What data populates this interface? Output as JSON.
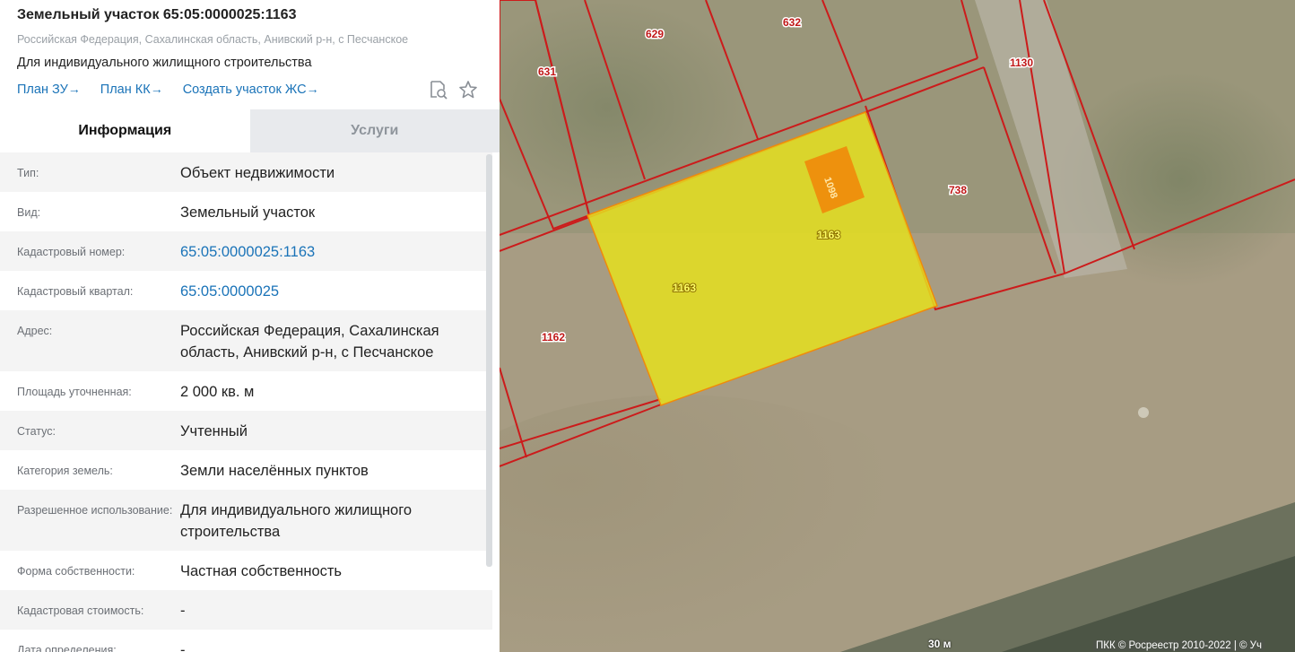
{
  "header": {
    "title": "Земельный участок 65:05:0000025:1163",
    "address": "Российская Федерация, Сахалинская область, Анивский р-н, с Песчанское",
    "purpose": "Для индивидуального жилищного строительства",
    "links": [
      {
        "label": "План ЗУ",
        "arrow": "→"
      },
      {
        "label": "План КК",
        "arrow": "→"
      },
      {
        "label": "Создать участок ЖС",
        "arrow": "→"
      }
    ],
    "icons": [
      "search-document-icon",
      "star-icon"
    ]
  },
  "tabs": [
    {
      "label": "Информация",
      "active": true
    },
    {
      "label": "Услуги",
      "active": false
    }
  ],
  "info_rows": [
    {
      "label": "Тип:",
      "value": "Объект недвижимости",
      "link": false
    },
    {
      "label": "Вид:",
      "value": "Земельный участок",
      "link": false
    },
    {
      "label": "Кадастровый номер:",
      "value": "65:05:0000025:1163",
      "link": true
    },
    {
      "label": "Кадастровый квартал:",
      "value": "65:05:0000025",
      "link": true
    },
    {
      "label": "Адрес:",
      "value": "Российская Федерация, Сахалинская область, Анивский р-н, с Песчанское",
      "link": false
    },
    {
      "label": "Площадь уточненная:",
      "value": "2 000 кв. м",
      "link": false
    },
    {
      "label": "Статус:",
      "value": "Учтенный",
      "link": false
    },
    {
      "label": "Категория земель:",
      "value": "Земли населённых пунктов",
      "link": false
    },
    {
      "label": "Разрешенное использование:",
      "value": "Для индивидуального жилищного строительства",
      "link": false
    },
    {
      "label": "Форма собственности:",
      "value": "Частная собственность",
      "link": false
    },
    {
      "label": "Кадастровая стоимость:",
      "value": "-",
      "link": false
    },
    {
      "label": "Дата определения:",
      "value": "-",
      "link": false
    }
  ],
  "map": {
    "parcel_labels": [
      "631",
      "629",
      "632",
      "1130",
      "738",
      "1163",
      "1163",
      "1162",
      "1098"
    ],
    "scale": "30 м",
    "copyright": "ПКК © Росреестр 2010-2022 | © Уч",
    "colors": {
      "boundary": "#cc1b1b",
      "selected_fill": "#e5e01f",
      "building_fill": "#f08a0a",
      "link": "#1a73b8"
    }
  }
}
